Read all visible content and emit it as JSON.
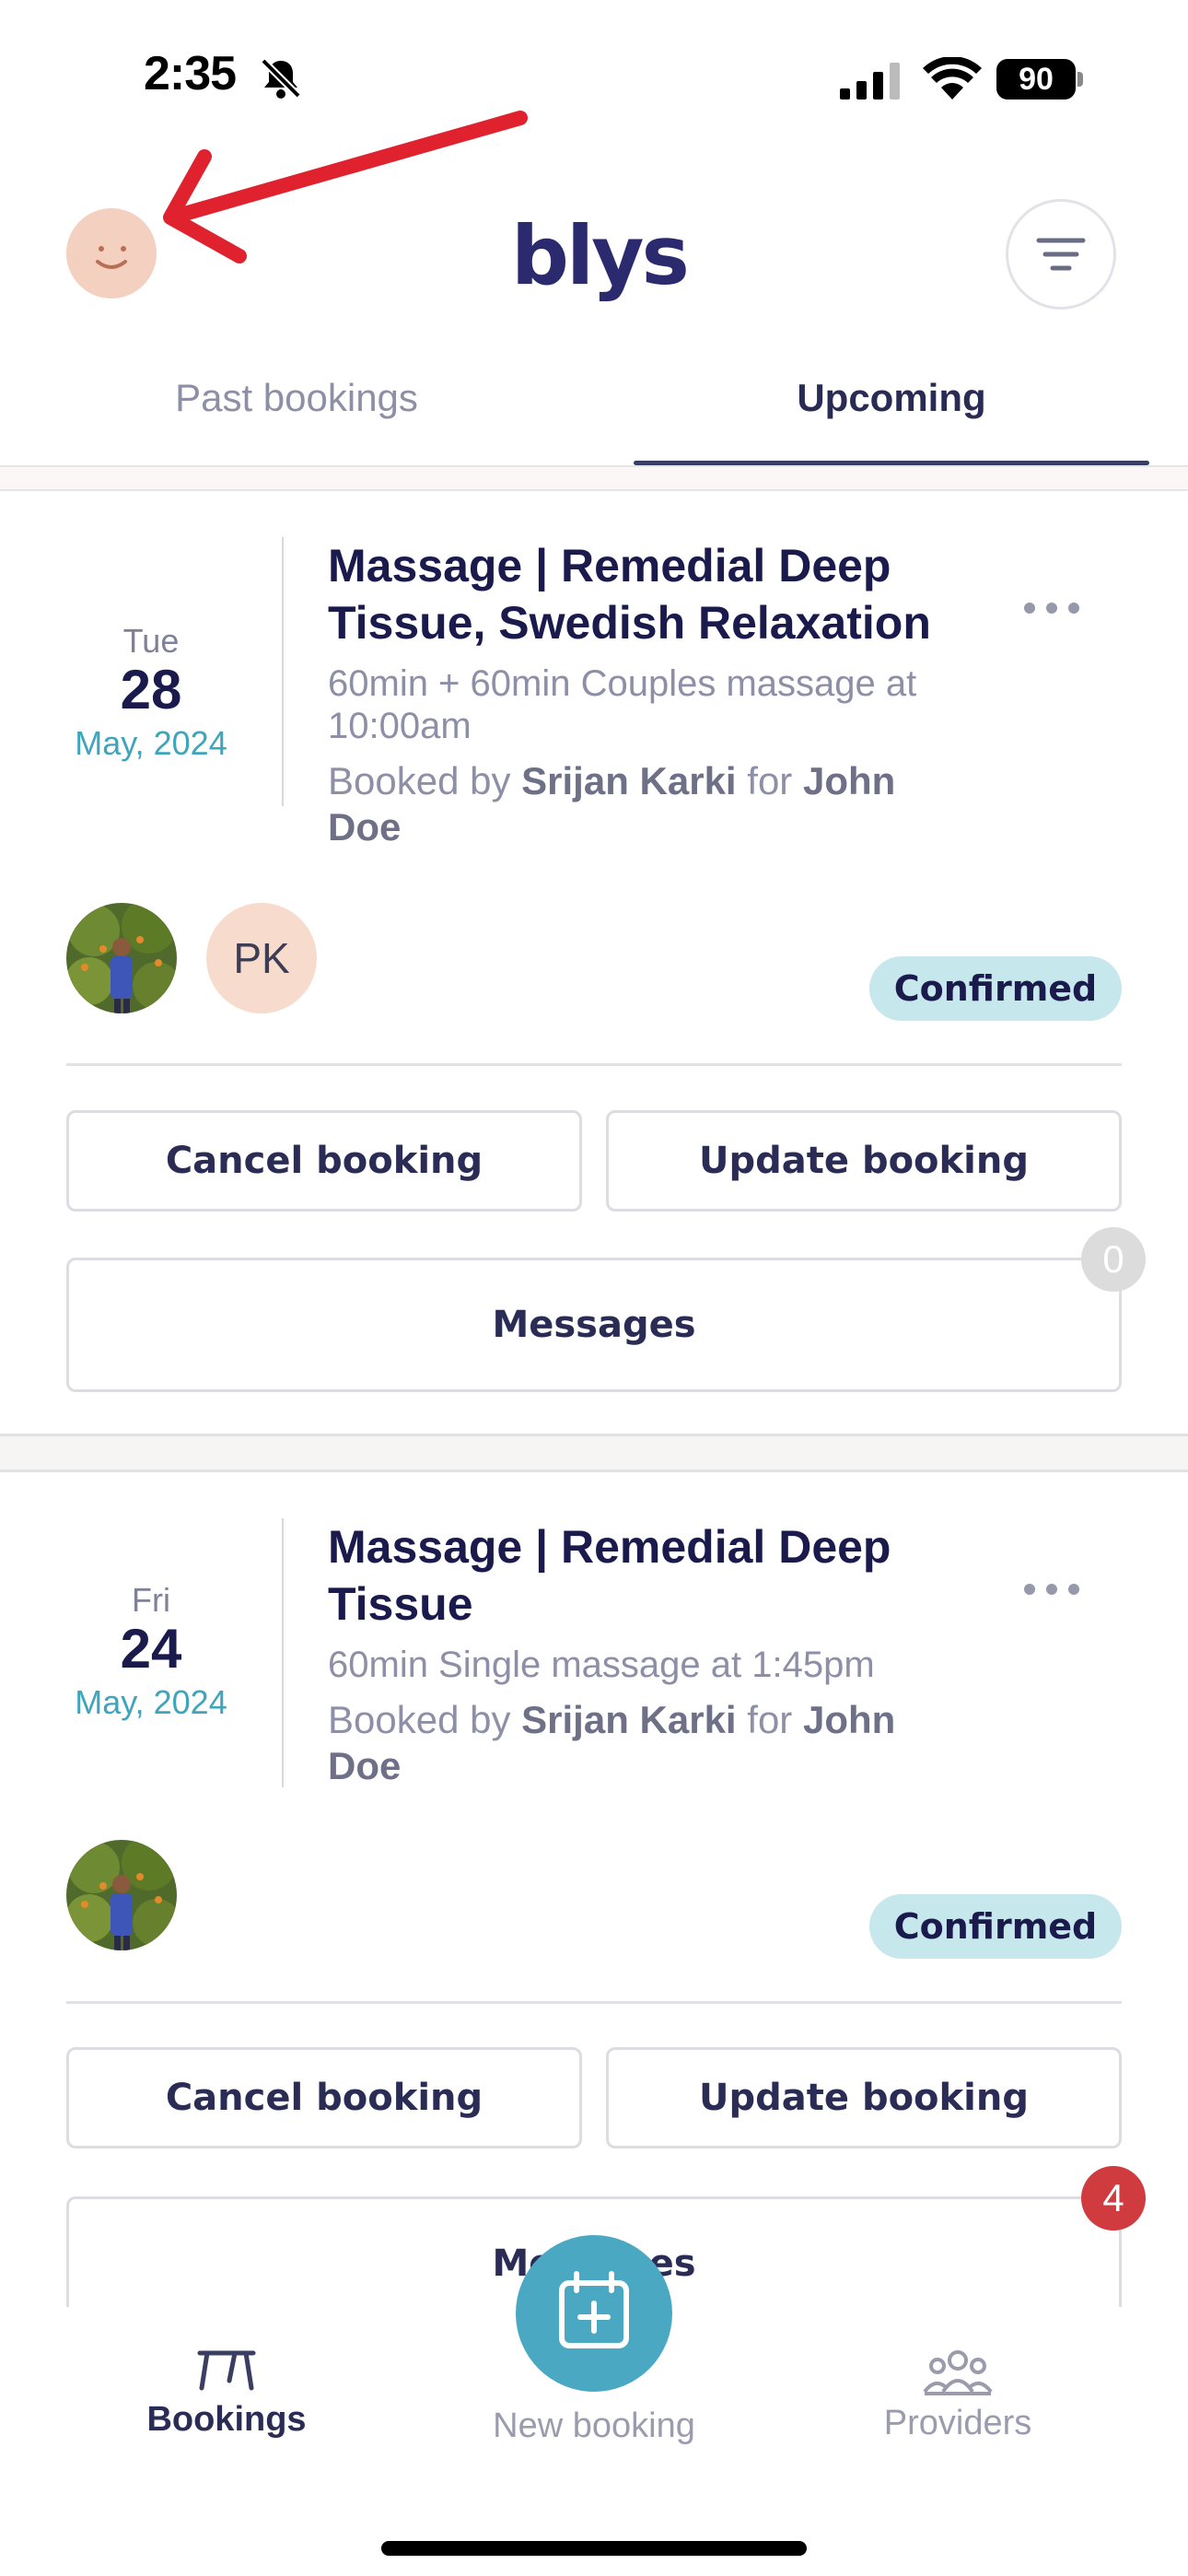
{
  "status_bar": {
    "time": "2:35",
    "battery": "90"
  },
  "header": {
    "brand": "blys"
  },
  "tabs": [
    {
      "label": "Past bookings",
      "active": false
    },
    {
      "label": "Upcoming",
      "active": true
    }
  ],
  "bookings": [
    {
      "dow": "Tue",
      "day": "28",
      "month": "May, 2024",
      "title_line1": "Massage | Remedial Deep",
      "title_line2": "Tissue, Swedish Relaxation",
      "detail_line1": "60min + 60min Couples massage at",
      "detail_line2": "10:00am",
      "booked_prefix": "Booked by",
      "booked_by": "Srijan Karki",
      "for_word": "for",
      "booked_for_line1": "John",
      "booked_for_line2": "Doe",
      "provider_initials": "PK",
      "status": "Confirmed",
      "cancel_label": "Cancel booking",
      "update_label": "Update booking",
      "messages_label": "Messages",
      "messages_count": "0"
    },
    {
      "dow": "Fri",
      "day": "24",
      "month": "May, 2024",
      "title_line1": "Massage | Remedial Deep",
      "title_line2": "Tissue",
      "detail_line1": "60min Single massage at 1:45pm",
      "booked_prefix": "Booked by",
      "booked_by": "Srijan Karki",
      "for_word": "for",
      "booked_for_line1": "John",
      "booked_for_line2": "Doe",
      "status": "Confirmed",
      "cancel_label": "Cancel booking",
      "update_label": "Update booking",
      "messages_label": "Messages",
      "messages_count": "4"
    }
  ],
  "bottom_nav": {
    "bookings": "Bookings",
    "new_booking": "New booking",
    "providers": "Providers"
  },
  "colors": {
    "accent": "#4aa8c2",
    "brand": "#2b2a6e",
    "badge_bg": "#c6e7ec",
    "alert": "#d03b3f",
    "annotation_arrow": "#e0222f"
  }
}
